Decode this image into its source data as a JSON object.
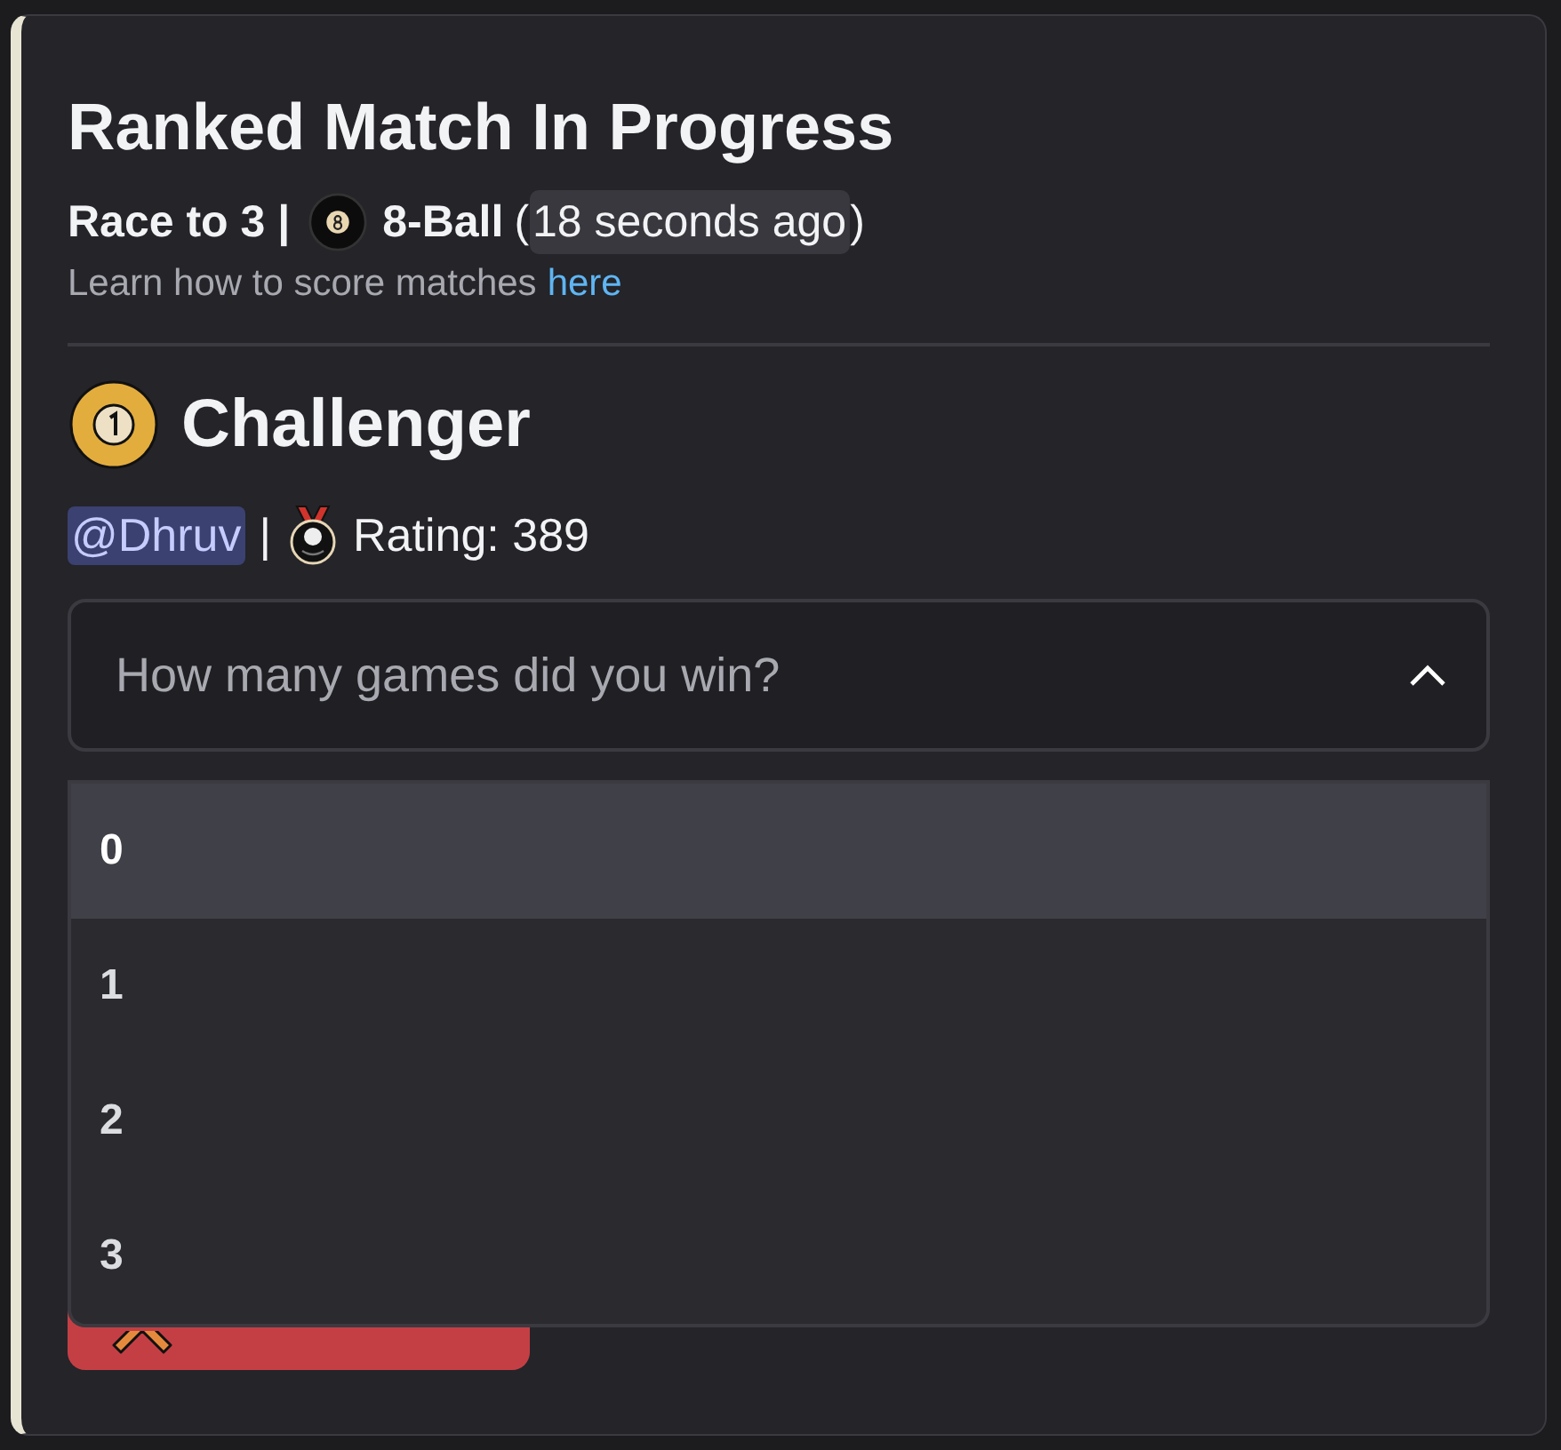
{
  "embed": {
    "title": "Ranked Match In Progress",
    "race": "Race to 3 |",
    "game": "8-Ball",
    "time_open": "(",
    "time": "18 seconds ago",
    "time_close": ")",
    "help_text": "Learn how to score matches",
    "help_link": "here"
  },
  "player": {
    "role": "Challenger",
    "mention": "@Dhruv",
    "separator": "|",
    "rating": "Rating: 389"
  },
  "select": {
    "placeholder": "How many games did you win?",
    "expanded": true,
    "options": [
      {
        "label": "0",
        "selected": true
      },
      {
        "label": "1",
        "selected": false
      },
      {
        "label": "2",
        "selected": false
      },
      {
        "label": "3",
        "selected": false
      }
    ]
  },
  "cancel_button": {
    "kind": "danger"
  }
}
